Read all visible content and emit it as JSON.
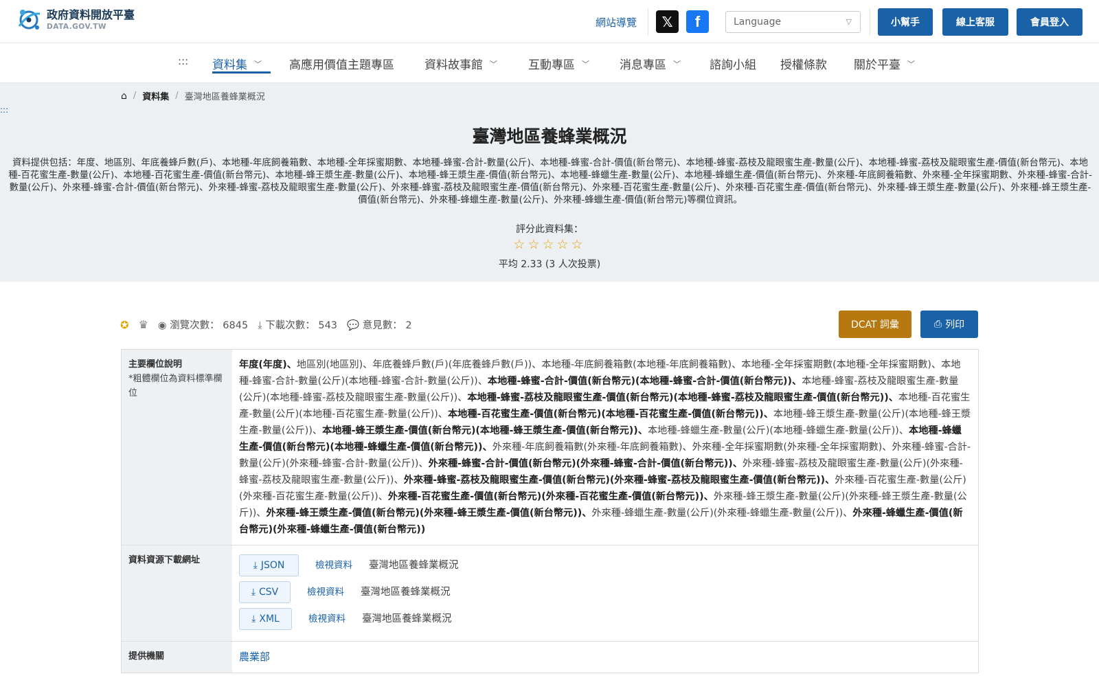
{
  "header": {
    "logo_text": "政府資料開放平臺",
    "logo_sub": "DATA.GOV.TW",
    "sitemap": "網站導覽",
    "social": {
      "x_icon": "x-icon",
      "fb_icon": "facebook-icon"
    },
    "language": "Language",
    "buttons": {
      "help": "小幫手",
      "service": "線上客服",
      "login": "會員登入"
    },
    "accent": "#1a62a8"
  },
  "nav": {
    "access_key": ":::",
    "items": [
      {
        "label": "資料集"
      },
      {
        "label": "高應用價值主題專區"
      },
      {
        "label": "資料故事館"
      },
      {
        "label": "互動專區"
      },
      {
        "label": "消息專區"
      },
      {
        "label": "諮詢小組"
      },
      {
        "label": "授權條款"
      },
      {
        "label": "關於平臺"
      }
    ]
  },
  "breadcrumb": {
    "dataset": "資料集",
    "current": "臺灣地區養蜂業概況"
  },
  "access_key2": ":::",
  "hero": {
    "title": "臺灣地區養蜂業概況",
    "description": "資料提供包括：年度、地區別、年底養蜂戶數(戶)、本地種-年底飼養箱數、本地種-全年採蜜期數、本地種-蜂蜜-合計-數量(公斤)、本地種-蜂蜜-合計-價值(新台幣元)、本地種-蜂蜜-荔枝及龍眼蜜生產-數量(公斤)、本地種-蜂蜜-荔枝及龍眼蜜生產-價值(新台幣元)、本地種-百花蜜生產-數量(公斤)、本地種-百花蜜生產-價值(新台幣元)、本地種-蜂王漿生產-數量(公斤)、本地種-蜂王漿生產-價值(新台幣元)、本地種-蜂蠟生產-數量(公斤)、本地種-蜂蠟生產-價值(新台幣元)、外來種-年底飼養箱數、外來種-全年採蜜期數、外來種-蜂蜜-合計-數量(公斤)、外來種-蜂蜜-合計-價值(新台幣元)、外來種-蜂蜜-荔枝及龍眼蜜生產-數量(公斤)、外來種-蜂蜜-荔枝及龍眼蜜生產-價值(新台幣元)、外來種-百花蜜生產-數量(公斤)、外來種-百花蜜生產-價值(新台幣元)、外來種-蜂王漿生產-數量(公斤)、外來種-蜂王漿生產-價值(新台幣元)、外來種-蜂蠟生產-數量(公斤)、外來種-蜂蠟生產-價值(新台幣元)等欄位資訊。",
    "rate_label": "評分此資料集：",
    "stars": "☆☆☆☆☆",
    "average": "平均 2.33 (3 人次投票)"
  },
  "stats": {
    "views_label": "瀏覽次數：",
    "views": "6845",
    "downloads_label": "下載次數：",
    "downloads": "543",
    "comments_label": "意見數：",
    "comments": "2",
    "dcat": "DCAT 詞彙",
    "print": "列印"
  },
  "table": {
    "fields_header": "主要欄位說明",
    "fields_note": "*粗體欄位為資料標準欄位",
    "fields": [
      {
        "text": "年度(年度)",
        "bold": true
      },
      {
        "text": "地區別(地區別)",
        "bold": false
      },
      {
        "text": "年底養蜂戶數(戶)(年底養蜂戶數(戶))",
        "bold": false
      },
      {
        "text": "本地種-年底飼養箱數(本地種-年底飼養箱數)",
        "bold": false
      },
      {
        "text": "本地種-全年採蜜期數(本地種-全年採蜜期數)",
        "bold": false
      },
      {
        "text": "本地種-蜂蜜-合計-數量(公斤)(本地種-蜂蜜-合計-數量(公斤))",
        "bold": false
      },
      {
        "text": "本地種-蜂蜜-合計-價值(新台幣元)(本地種-蜂蜜-合計-價值(新台幣元))",
        "bold": true
      },
      {
        "text": "本地種-蜂蜜-荔枝及龍眼蜜生產-數量(公斤)(本地種-蜂蜜-荔枝及龍眼蜜生產-數量(公斤))",
        "bold": false
      },
      {
        "text": "本地種-蜂蜜-荔枝及龍眼蜜生產-價值(新台幣元)(本地種-蜂蜜-荔枝及龍眼蜜生產-價值(新台幣元))",
        "bold": true
      },
      {
        "text": "本地種-百花蜜生產-數量(公斤)(本地種-百花蜜生產-數量(公斤))",
        "bold": false
      },
      {
        "text": "本地種-百花蜜生產-價值(新台幣元)(本地種-百花蜜生產-價值(新台幣元))",
        "bold": true
      },
      {
        "text": "本地種-蜂王漿生產-數量(公斤)(本地種-蜂王漿生產-數量(公斤))",
        "bold": false
      },
      {
        "text": "本地種-蜂王漿生產-價值(新台幣元)(本地種-蜂王漿生產-價值(新台幣元))",
        "bold": true
      },
      {
        "text": "本地種-蜂蠟生產-數量(公斤)(本地種-蜂蠟生產-數量(公斤))",
        "bold": false
      },
      {
        "text": "本地種-蜂蠟生產-價值(新台幣元)(本地種-蜂蠟生產-價值(新台幣元))",
        "bold": true
      },
      {
        "text": "外來種-年底飼養箱數(外來種-年底飼養箱數)",
        "bold": false
      },
      {
        "text": "外來種-全年採蜜期數(外來種-全年採蜜期數)",
        "bold": false
      },
      {
        "text": "外來種-蜂蜜-合計-數量(公斤)(外來種-蜂蜜-合計-數量(公斤))",
        "bold": false
      },
      {
        "text": "外來種-蜂蜜-合計-價值(新台幣元)(外來種-蜂蜜-合計-價值(新台幣元))",
        "bold": true
      },
      {
        "text": "外來種-蜂蜜-荔枝及龍眼蜜生產-數量(公斤)(外來種-蜂蜜-荔枝及龍眼蜜生產-數量(公斤))",
        "bold": false
      },
      {
        "text": "外來種-蜂蜜-荔枝及龍眼蜜生產-價值(新台幣元)(外來種-蜂蜜-荔枝及龍眼蜜生產-價值(新台幣元))",
        "bold": true
      },
      {
        "text": "外來種-百花蜜生產-數量(公斤)(外來種-百花蜜生產-數量(公斤))",
        "bold": false
      },
      {
        "text": "外來種-百花蜜生產-價值(新台幣元)(外來種-百花蜜生產-價值(新台幣元))",
        "bold": true
      },
      {
        "text": "外來種-蜂王漿生產-數量(公斤)(外來種-蜂王漿生產-數量(公斤))",
        "bold": false
      },
      {
        "text": "外來種-蜂王漿生產-價值(新台幣元)(外來種-蜂王漿生產-價值(新台幣元))",
        "bold": true
      },
      {
        "text": "外來種-蜂蠟生產-數量(公斤)(外來種-蜂蠟生產-數量(公斤))",
        "bold": false
      },
      {
        "text": "外來種-蜂蠟生產-價值(新台幣元)(外來種-蜂蠟生產-價值(新台幣元))",
        "bold": true
      }
    ],
    "download_header": "資料資源下載網址",
    "downloads": [
      {
        "format": "JSON",
        "view": "檢視資料",
        "title": "臺灣地區養蜂業概況"
      },
      {
        "format": "CSV",
        "view": "檢視資料",
        "title": "臺灣地區養蜂業概況"
      },
      {
        "format": "XML",
        "view": "檢視資料",
        "title": "臺灣地區養蜂業概況"
      }
    ],
    "org_header": "提供機關",
    "org": "農業部"
  }
}
